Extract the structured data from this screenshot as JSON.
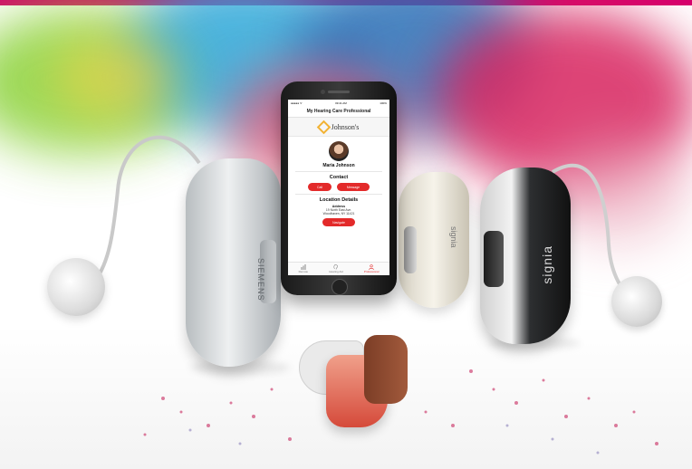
{
  "brand_color": "#d6006c",
  "phone": {
    "status": {
      "carrier": "●●●●● ᯤ",
      "time": "09:41 AM",
      "battery": "100%"
    },
    "nav_title": "My Hearing Care Professional",
    "clinic_logo_text": "Johnson's",
    "professional_name": "Maria Johnson",
    "contact_heading": "Contact",
    "call_button": "Call",
    "message_button": "Message",
    "location_heading": "Location Details",
    "address_label": "Address",
    "address_line1": "19 North East Ave.",
    "address_line2": "Woodhaven, NY 11421",
    "navigate_button": "Navigate",
    "tabs": [
      {
        "label": "Remote",
        "icon": "bars-icon"
      },
      {
        "label": "Hearing Aid",
        "icon": "ear-icon"
      },
      {
        "label": "Professional",
        "icon": "person-icon"
      }
    ],
    "active_tab": "Professional"
  },
  "hearing_aids": {
    "left_brand": "SIEMENS",
    "middle_brand": "signia",
    "right_brand": "signia"
  },
  "accent_colors": {
    "green": "#8bd23a",
    "blue": "#2b6fb6",
    "pink": "#d8245f",
    "button_red": "#e32a2a"
  }
}
